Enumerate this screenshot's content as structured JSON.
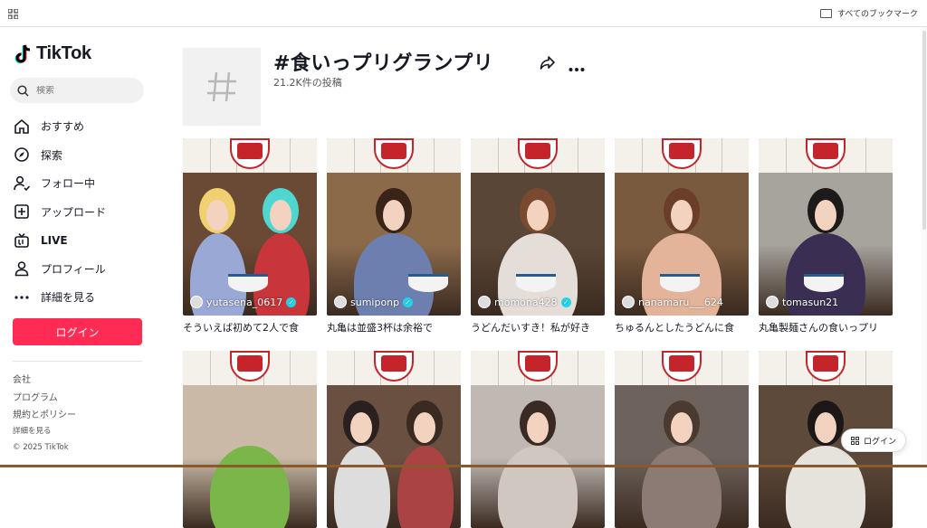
{
  "browser": {
    "bookmarks_label": "すべてのブックマーク"
  },
  "sidebar": {
    "logo_text": "TikTok",
    "search_placeholder": "検索",
    "nav": [
      {
        "label": "おすすめ",
        "icon": "home-icon"
      },
      {
        "label": "探索",
        "icon": "compass-icon"
      },
      {
        "label": "フォロー中",
        "icon": "user-follow-icon"
      },
      {
        "label": "アップロード",
        "icon": "upload-plus-icon"
      },
      {
        "label": "LIVE",
        "icon": "live-tv-icon"
      },
      {
        "label": "プロフィール",
        "icon": "profile-icon"
      },
      {
        "label": "詳細を見る",
        "icon": "more-dots-icon"
      }
    ],
    "login_label": "ログイン",
    "footer": [
      "会社",
      "プログラム",
      "規約とポリシー"
    ],
    "footer_more": "詳細を見る",
    "copyright": "© 2025 TikTok"
  },
  "tag": {
    "title": "#食いっプリグランプリ",
    "count": "21.2K件の投稿"
  },
  "videos": [
    {
      "user": "yutasena_0617",
      "verified": true,
      "caption": "そういえば初めて2人で食"
    },
    {
      "user": "sumiponp",
      "verified": true,
      "caption": "丸亀は並盛3杯は余裕で"
    },
    {
      "user": "momona428",
      "verified": true,
      "caption": "うどんだいすき！私が好き"
    },
    {
      "user": "nanamaru___624",
      "verified": false,
      "caption": "ちゅるんとしたうどんに食"
    },
    {
      "user": "tomasun21",
      "verified": false,
      "caption": "丸亀製麺さんの食いっプリ"
    },
    {
      "user": "",
      "verified": false,
      "caption": ""
    },
    {
      "user": "",
      "verified": false,
      "caption": ""
    },
    {
      "user": "",
      "verified": false,
      "caption": ""
    },
    {
      "user": "",
      "verified": false,
      "caption": ""
    },
    {
      "user": "",
      "verified": false,
      "caption": ""
    }
  ],
  "float_login": "ログイン",
  "colors": {
    "accent": "#fe2c55",
    "verified": "#20d5ec"
  }
}
